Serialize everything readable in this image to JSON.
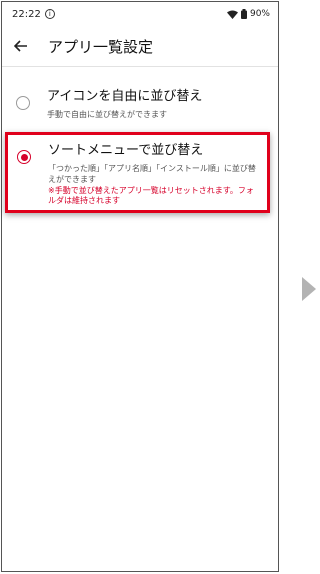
{
  "status_bar": {
    "time": "22:22",
    "battery": "90%"
  },
  "app_bar": {
    "title": "アプリ一覧設定"
  },
  "options": [
    {
      "title": "アイコンを自由に並び替え",
      "description": "手動で自由に並び替えができます",
      "selected": false
    },
    {
      "title": "ソートメニューで並び替え",
      "description": "「つかった順」「アプリ名順」「インストール順」に並び替えができます",
      "warning": "※手動で並び替えたアプリ一覧はリセットされます。フォルダは維持されます",
      "selected": true
    }
  ],
  "colors": {
    "accent": "#d6002a",
    "highlight_border": "#e0001b",
    "next_arrow": "#b3b3b3"
  },
  "icons": {
    "back": "arrow-left",
    "info": "info-circle",
    "wifi": "wifi",
    "battery": "battery",
    "next": "triangle-right"
  }
}
